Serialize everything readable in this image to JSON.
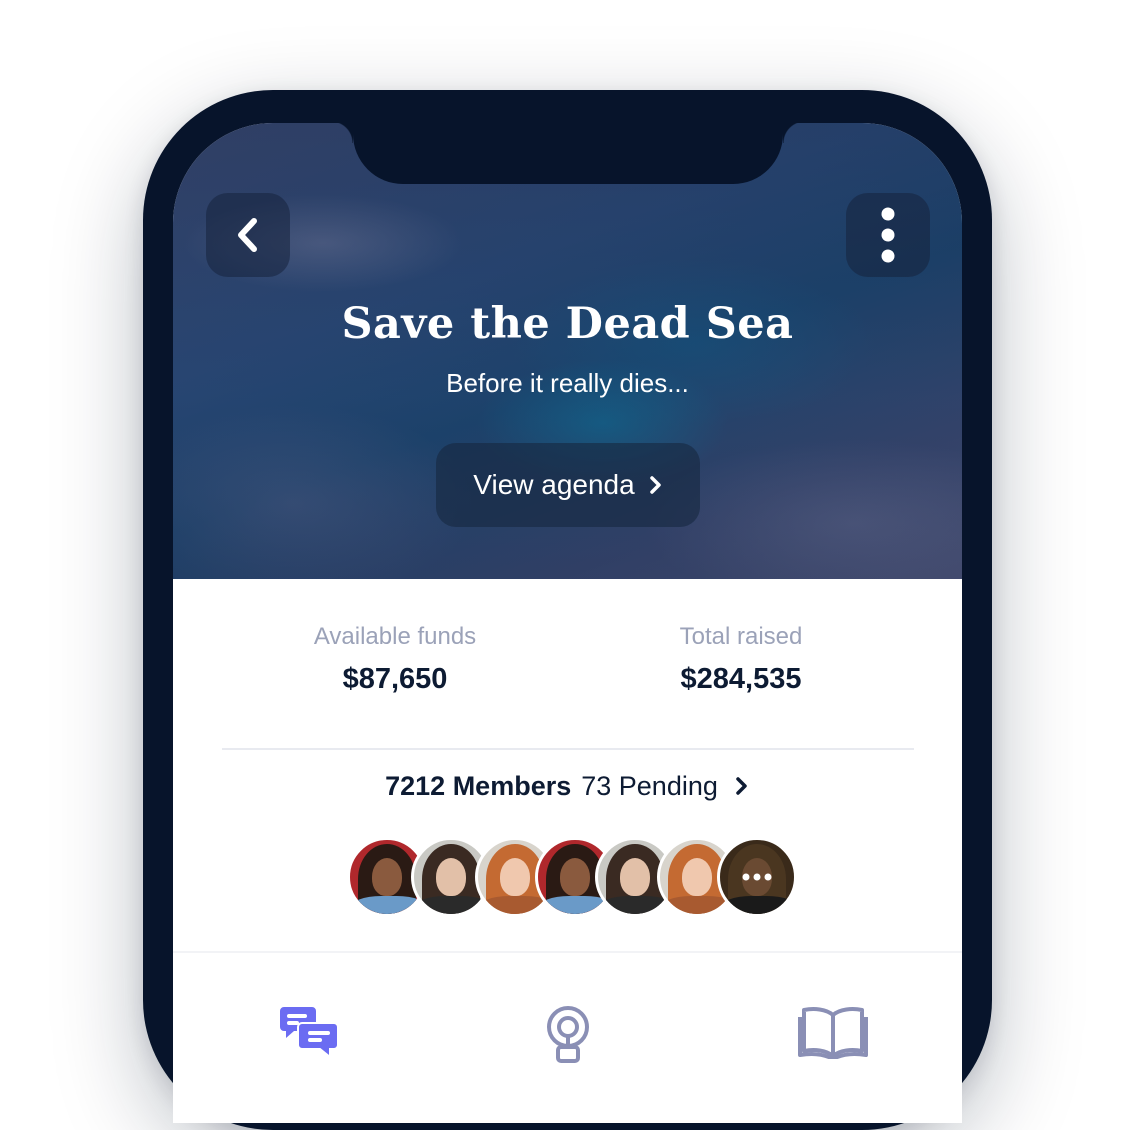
{
  "hero": {
    "title": "Save the Dead Sea",
    "subtitle": "Before it really dies...",
    "agenda_label": "View agenda"
  },
  "stats": {
    "available_label": "Available funds",
    "available_value": "$87,650",
    "raised_label": "Total raised",
    "raised_value": "$284,535"
  },
  "members": {
    "count": "7212 Members",
    "pending": "73 Pending"
  },
  "icons": {
    "back": "chevron-left-icon",
    "more": "more-vertical-icon",
    "agenda_arrow": "chevron-right-icon",
    "members_arrow": "chevron-right-icon",
    "tab_chat": "chat-icon",
    "tab_ideas": "lightbulb-icon",
    "tab_library": "book-icon"
  },
  "colors": {
    "frame": "#07142b",
    "text_dark": "#0d1b33",
    "text_muted": "#9ba2b8",
    "accent": "#6b6cf2",
    "tab_inactive": "#8a8fb5"
  }
}
